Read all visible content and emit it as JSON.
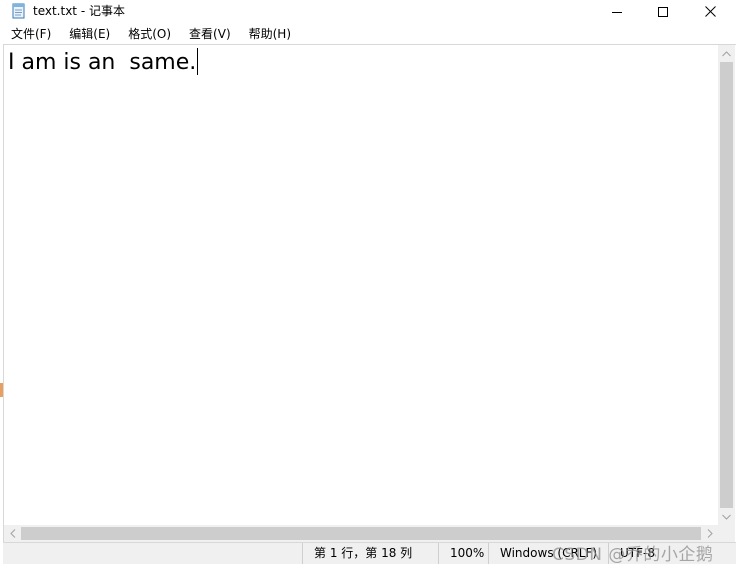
{
  "window": {
    "title": "text.txt - 记事本"
  },
  "menu": {
    "items": [
      "文件(F)",
      "编辑(E)",
      "格式(O)",
      "查看(V)",
      "帮助(H)"
    ]
  },
  "editor": {
    "content": "I am is an  same."
  },
  "status": {
    "position": "第 1 行，第 18 列",
    "zoom": "100%",
    "line_ending": "Windows (CRLF)",
    "encoding": "UTF-8"
  },
  "watermark": {
    "text": "CSDN @乔的小企鹅"
  },
  "icons": {
    "app": "notepad-icon",
    "minimize": "minimize-icon",
    "maximize": "maximize-icon",
    "close": "close-icon"
  },
  "colors": {
    "chrome": "#f0f0f0",
    "scroll_thumb": "#cdcdcd",
    "text": "#000000"
  }
}
